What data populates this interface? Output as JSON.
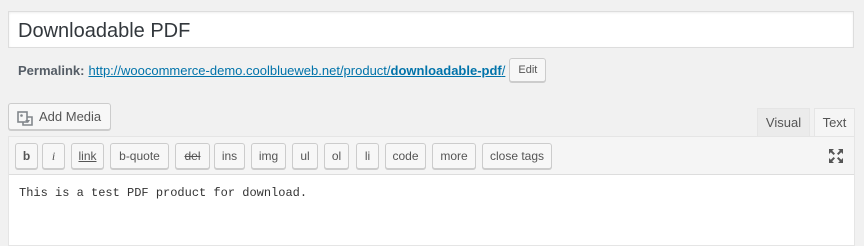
{
  "post": {
    "title": "Downloadable PDF"
  },
  "permalink": {
    "label": "Permalink:",
    "url_base": "http://woocommerce-demo.coolblueweb.net/product/",
    "slug": "downloadable-pdf",
    "url_trailing": "/",
    "edit_label": "Edit"
  },
  "media": {
    "add_media_label": "Add Media",
    "icon": "add-media-icon"
  },
  "tabs": {
    "visual_label": "Visual",
    "text_label": "Text",
    "active": "Text"
  },
  "quicktags": [
    {
      "label": "b"
    },
    {
      "label": "i"
    },
    {
      "label": "link"
    },
    {
      "label": "b-quote"
    },
    {
      "label": "del"
    },
    {
      "label": "ins"
    },
    {
      "label": "img"
    },
    {
      "label": "ul"
    },
    {
      "label": "ol"
    },
    {
      "label": "li"
    },
    {
      "label": "code"
    },
    {
      "label": "more"
    },
    {
      "label": "close tags"
    }
  ],
  "editor": {
    "content": "This is a test PDF product for download.",
    "fullscreen_icon": "fullscreen-icon"
  },
  "colors": {
    "link": "#0073aa",
    "background": "#f1f1f1"
  }
}
